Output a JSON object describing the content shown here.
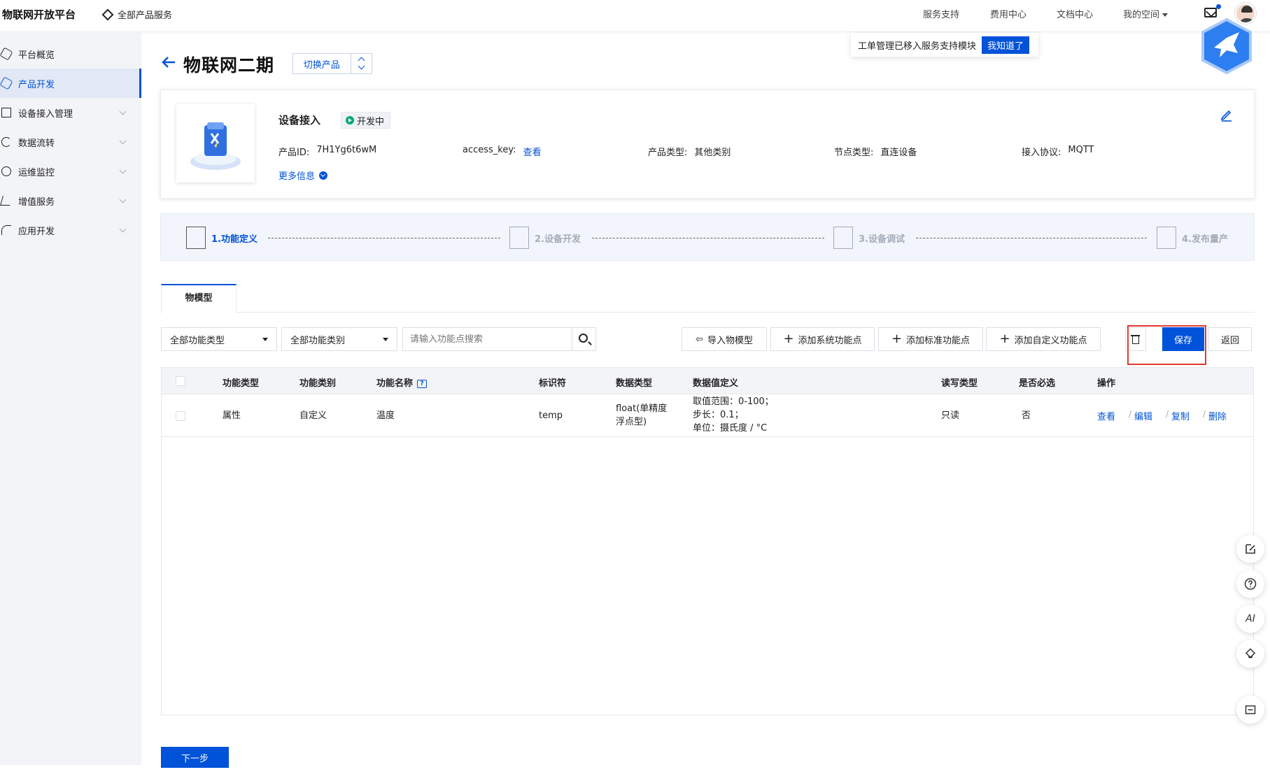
{
  "topbar": {
    "brand": "物联网开放平台",
    "all_services": "全部产品服务",
    "nav": [
      "服务支持",
      "费用中心",
      "文档中心",
      "我的空间"
    ]
  },
  "notice": {
    "text": "工单管理已移入服务支持模块",
    "button": "我知道了"
  },
  "sidebar": {
    "items": [
      {
        "label": "平台概览",
        "icon": "hexagon-icon",
        "expandable": false
      },
      {
        "label": "产品开发",
        "icon": "cube-icon",
        "expandable": false,
        "active": true
      },
      {
        "label": "设备接入管理",
        "icon": "device-icon",
        "expandable": true
      },
      {
        "label": "数据流转",
        "icon": "cycle-icon",
        "expandable": true
      },
      {
        "label": "运维监控",
        "icon": "clock-icon",
        "expandable": true
      },
      {
        "label": "增值服务",
        "icon": "send-icon",
        "expandable": true
      },
      {
        "label": "应用开发",
        "icon": "arc-icon",
        "expandable": true
      }
    ]
  },
  "header": {
    "title": "物联网二期",
    "switch_label": "切换产品"
  },
  "product": {
    "name": "设备接入",
    "status": "开发中",
    "fields": [
      {
        "label": "产品ID:",
        "value": "7H1Yg6t6wM"
      },
      {
        "label": "access_key:",
        "value": "查看",
        "link": true
      },
      {
        "label": "产品类型:",
        "value": "其他类别"
      },
      {
        "label": "节点类型:",
        "value": "直连设备"
      },
      {
        "label": "接入协议:",
        "value": "MQTT"
      }
    ],
    "more": "更多信息"
  },
  "steps": [
    {
      "label": "1.功能定义",
      "active": true
    },
    {
      "label": "2.设备开发",
      "active": false
    },
    {
      "label": "3.设备调试",
      "active": false
    },
    {
      "label": "4.发布量产",
      "active": false
    }
  ],
  "tabs": [
    "物模型"
  ],
  "toolbar": {
    "filter_type": "全部功能类型",
    "filter_category": "全部功能类别",
    "search_placeholder": "请输入功能点搜索",
    "import": "导入物模型",
    "add_system": "添加系统功能点",
    "add_standard": "添加标准功能点",
    "add_custom": "添加自定义功能点",
    "save": "保存",
    "back": "返回"
  },
  "table": {
    "headers": [
      "功能类型",
      "功能类别",
      "功能名称",
      "标识符",
      "数据类型",
      "数据值定义",
      "读写类型",
      "是否必选",
      "操作"
    ],
    "rows": [
      {
        "type": "属性",
        "category": "自定义",
        "name": "温度",
        "identifier": "temp",
        "data_type_1": "float(单精度",
        "data_type_2": "浮点型)",
        "def_1": "取值范围：0-100；",
        "def_2": "步长：0.1；",
        "def_3": "单位：摄氏度 / °C",
        "rw": "只读",
        "required": "否",
        "ops": [
          "查看",
          "编辑",
          "复制",
          "删除"
        ]
      }
    ]
  },
  "next_button": "下一步",
  "float_buttons": {
    "ai": "AI"
  }
}
